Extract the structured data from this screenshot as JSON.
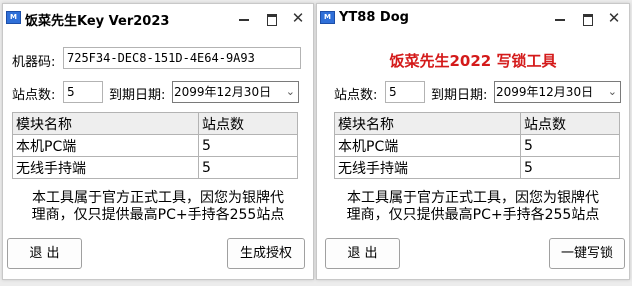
{
  "left_window": {
    "title": "饭菜先生Key Ver2023",
    "machine_code_label": "机器码:",
    "machine_code_value": "725F34-DEC8-151D-4E64-9A93",
    "sites_label": "站点数:",
    "sites_value": "5",
    "expiry_label": "到期日期:",
    "expiry_value": "2099年12月30日",
    "table": {
      "headers": [
        "模块名称",
        "站点数"
      ],
      "rows": [
        [
          "本机PC端",
          "5"
        ],
        [
          "无线手持端",
          "5"
        ]
      ]
    },
    "notice": [
      "本工具属于官方正式工具，因您为银牌代",
      "理商，仅只提供最高PC+手持各255站点"
    ],
    "exit_button": "退  出",
    "generate_button": "生成授权"
  },
  "right_window": {
    "title": "YT88 Dog",
    "heading": "饭菜先生2022  写锁工具",
    "sites_label": "站点数:",
    "sites_value": "5",
    "expiry_label": "到期日期:",
    "expiry_value": "2099年12月30日",
    "table": {
      "headers": [
        "模块名称",
        "站点数"
      ],
      "rows": [
        [
          "本机PC端",
          "5"
        ],
        [
          "无线手持端",
          "5"
        ]
      ]
    },
    "notice": [
      "本工具属于官方正式工具，因您为银牌代",
      "理商，仅只提供最高PC+手持各255站点"
    ],
    "exit_button": "退  出",
    "write_button": "一键写锁"
  },
  "colors": {
    "heading_red": "#d41a1a"
  },
  "icons": [
    "app-icon",
    "minimize-icon",
    "maximize-icon",
    "close-icon",
    "chevron-down-icon"
  ]
}
